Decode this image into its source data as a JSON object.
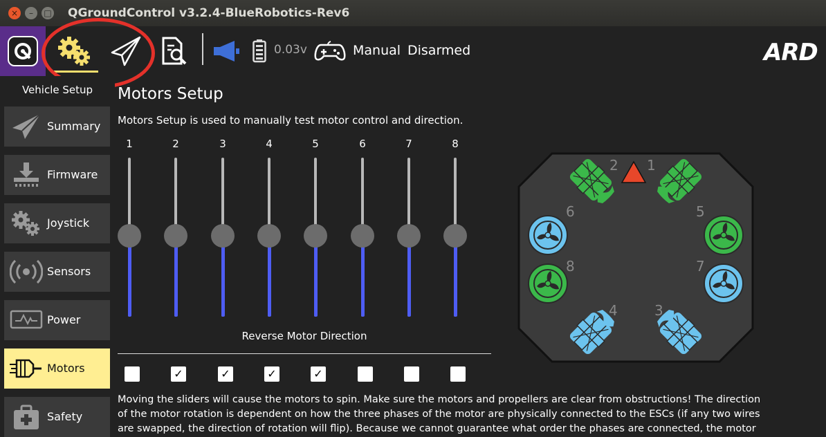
{
  "window": {
    "title": "QGroundControl v3.2.4-BlueRobotics-Rev6",
    "close_glyph": "×",
    "minimize_glyph": "–",
    "maximize_glyph": "□"
  },
  "toolbar": {
    "battery_voltage": "0.03v",
    "flight_mode": "Manual",
    "arm_status": "Disarmed",
    "brand_logo": "ARD"
  },
  "sidebar": {
    "title": "Vehicle Setup",
    "items": [
      {
        "label": "Summary",
        "icon": "paper-plane-icon"
      },
      {
        "label": "Firmware",
        "icon": "firmware-download-icon"
      },
      {
        "label": "Joystick",
        "icon": "gears-icon"
      },
      {
        "label": "Sensors",
        "icon": "radio-waves-icon"
      },
      {
        "label": "Power",
        "icon": "power-monitor-icon"
      },
      {
        "label": "Motors",
        "icon": "motor-icon"
      },
      {
        "label": "Safety",
        "icon": "first-aid-kit-icon"
      }
    ],
    "active": "Motors"
  },
  "main": {
    "title": "Motors Setup",
    "description": "Motors Setup is used to manually test motor control and direction.",
    "motors": [
      {
        "number": "1",
        "reversed": false
      },
      {
        "number": "2",
        "reversed": true
      },
      {
        "number": "3",
        "reversed": true
      },
      {
        "number": "4",
        "reversed": true
      },
      {
        "number": "5",
        "reversed": true
      },
      {
        "number": "6",
        "reversed": false
      },
      {
        "number": "7",
        "reversed": false
      },
      {
        "number": "8",
        "reversed": false
      }
    ],
    "slider_level": 0.5,
    "reverse_label": "Reverse Motor Direction",
    "check_glyph": "✓",
    "warning_lines": [
      "Moving the sliders will cause the motors to spin. Make sure the motors and propellers are clear from obstructions! The direction",
      "of the motor rotation is dependent on how the three phases of the motor are physically connected to the ESCs (if any two wires",
      "are swapped, the direction of rotation will flip). Because we cannot guarantee what order the phases are connected, the motor"
    ]
  },
  "diagram": {
    "motor_labels": [
      "1",
      "2",
      "3",
      "4",
      "5",
      "6",
      "7",
      "8"
    ],
    "colors": {
      "green": "#3bb84a",
      "blue": "#6cc3ee",
      "body": "#3b3b3b",
      "heading": "#e8472a"
    }
  },
  "colors": {
    "accent_yellow": "#ffee92",
    "slider_blue": "#4e5df4",
    "annotation_red": "#e4312a",
    "qgc_purple": "#5a2d8a"
  }
}
